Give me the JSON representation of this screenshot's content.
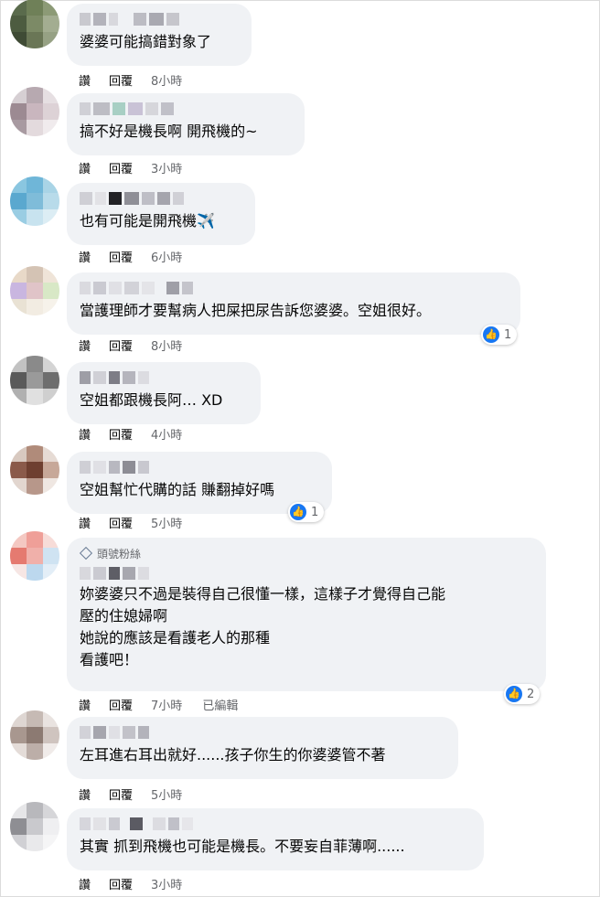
{
  "labels": {
    "like": "讚",
    "reply": "回覆",
    "edited": "已編輯",
    "like_icon": "thumbs-up-icon"
  },
  "comments": [
    {
      "text": "婆婆可能搞錯對象了",
      "time": "8小時"
    },
    {
      "text": "搞不好是機長啊 開飛機的~",
      "time": "3小時"
    },
    {
      "text": "也有可能是開飛機✈️",
      "time": "6小時"
    },
    {
      "text": "當護理師才要幫病人把屎把尿告訴您婆婆。空姐很好。",
      "time": "8小時",
      "likes": "1"
    },
    {
      "text": "空姐都跟機長阿… XD",
      "time": "4小時"
    },
    {
      "text": "空姐幫忙代購的話 賺翻掉好嗎",
      "time": "5小時",
      "likes": "1"
    },
    {
      "badge": "頭號粉絲",
      "text": "妳婆婆只不過是裝得自己很懂一樣，這樣子才覺得自己能\n壓的住媳婦啊\n她說的應該是看護老人的那種\n看護吧！",
      "time": "7小時",
      "likes": "2"
    },
    {
      "text": "左耳進右耳出就好......孩子你生的你婆婆管不著",
      "time": "5小時"
    },
    {
      "text": "其實 抓到飛機也可能是機長。不要妄自菲薄啊......",
      "time": "3小時"
    }
  ]
}
